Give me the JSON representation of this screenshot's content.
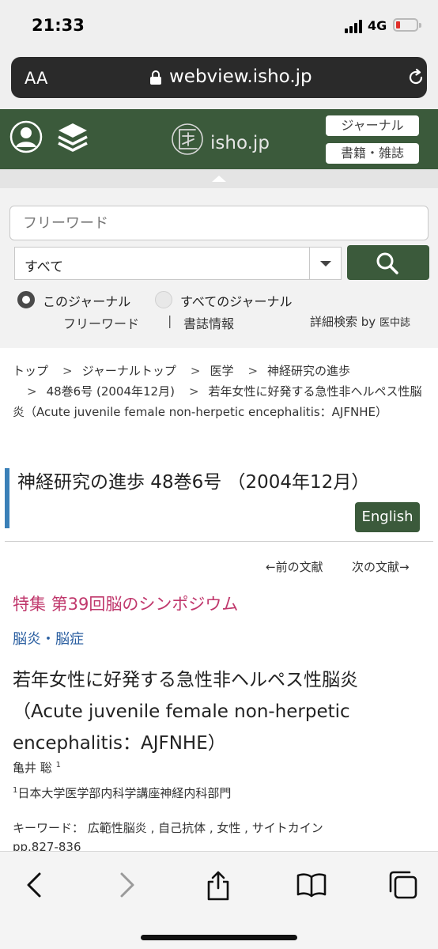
{
  "status": {
    "time": "21:33",
    "network": "4G"
  },
  "browser": {
    "aa_label": "AA",
    "url": "webview.isho.jp"
  },
  "header": {
    "logo_text": "isho.jp",
    "journal_btn": "ジャーナル",
    "books_btn": "書籍・雑誌"
  },
  "search": {
    "placeholder": "フリーワード",
    "scope": "すべて",
    "radio_this": "このジャーナル",
    "radio_all": "すべてのジャーナル",
    "opt_freeword": "フリーワード",
    "opt_separator": "|",
    "opt_bib": "書誌情報",
    "advanced": "詳細検索 by",
    "advanced_by": "医中誌"
  },
  "breadcrumb": {
    "separator": ">",
    "items": [
      "トップ",
      "ジャーナルトップ",
      "医学",
      "神経研究の進歩",
      "48巻6号 (2004年12月)",
      "若年女性に好発する急性非ヘルペス性脳炎（Acute juvenile female non-herpetic encephalitis：AJFNHE）"
    ]
  },
  "journal": {
    "title": "神経研究の進歩 48巻6号 （2004年12月）",
    "english_btn": "English"
  },
  "nav": {
    "prev": "←前の文献",
    "next": "次の文献→"
  },
  "article": {
    "special": "特集 第39回脳のシンポジウム",
    "category": "脳炎・脳症",
    "title": "若年女性に好発する急性非ヘルペス性脳炎（Acute juvenile female non-herpetic encephalitis：AJFNHE）",
    "author": "亀井 聡",
    "author_sup": "1",
    "affil_sup": "1",
    "affiliation": "日本大学医学部内科学講座神経内科部門",
    "keywords_label": "キーワード：",
    "keywords": "広範性脳炎 , 自己抗体 , 女性 , サイトカイン",
    "pages": "pp.827-836"
  },
  "icons": [
    "signal-icon",
    "battery-icon",
    "lock-icon",
    "reload-icon",
    "user-icon",
    "layers-icon",
    "isho-logo-icon",
    "search-icon",
    "back-icon",
    "forward-icon",
    "share-icon",
    "bookmarks-icon",
    "tabs-icon"
  ],
  "colors": {
    "brand_green": "#3b5a3b",
    "special_pink": "#c0386c",
    "link_blue": "#2a5ea0",
    "accent_bar": "#3a80b8"
  }
}
